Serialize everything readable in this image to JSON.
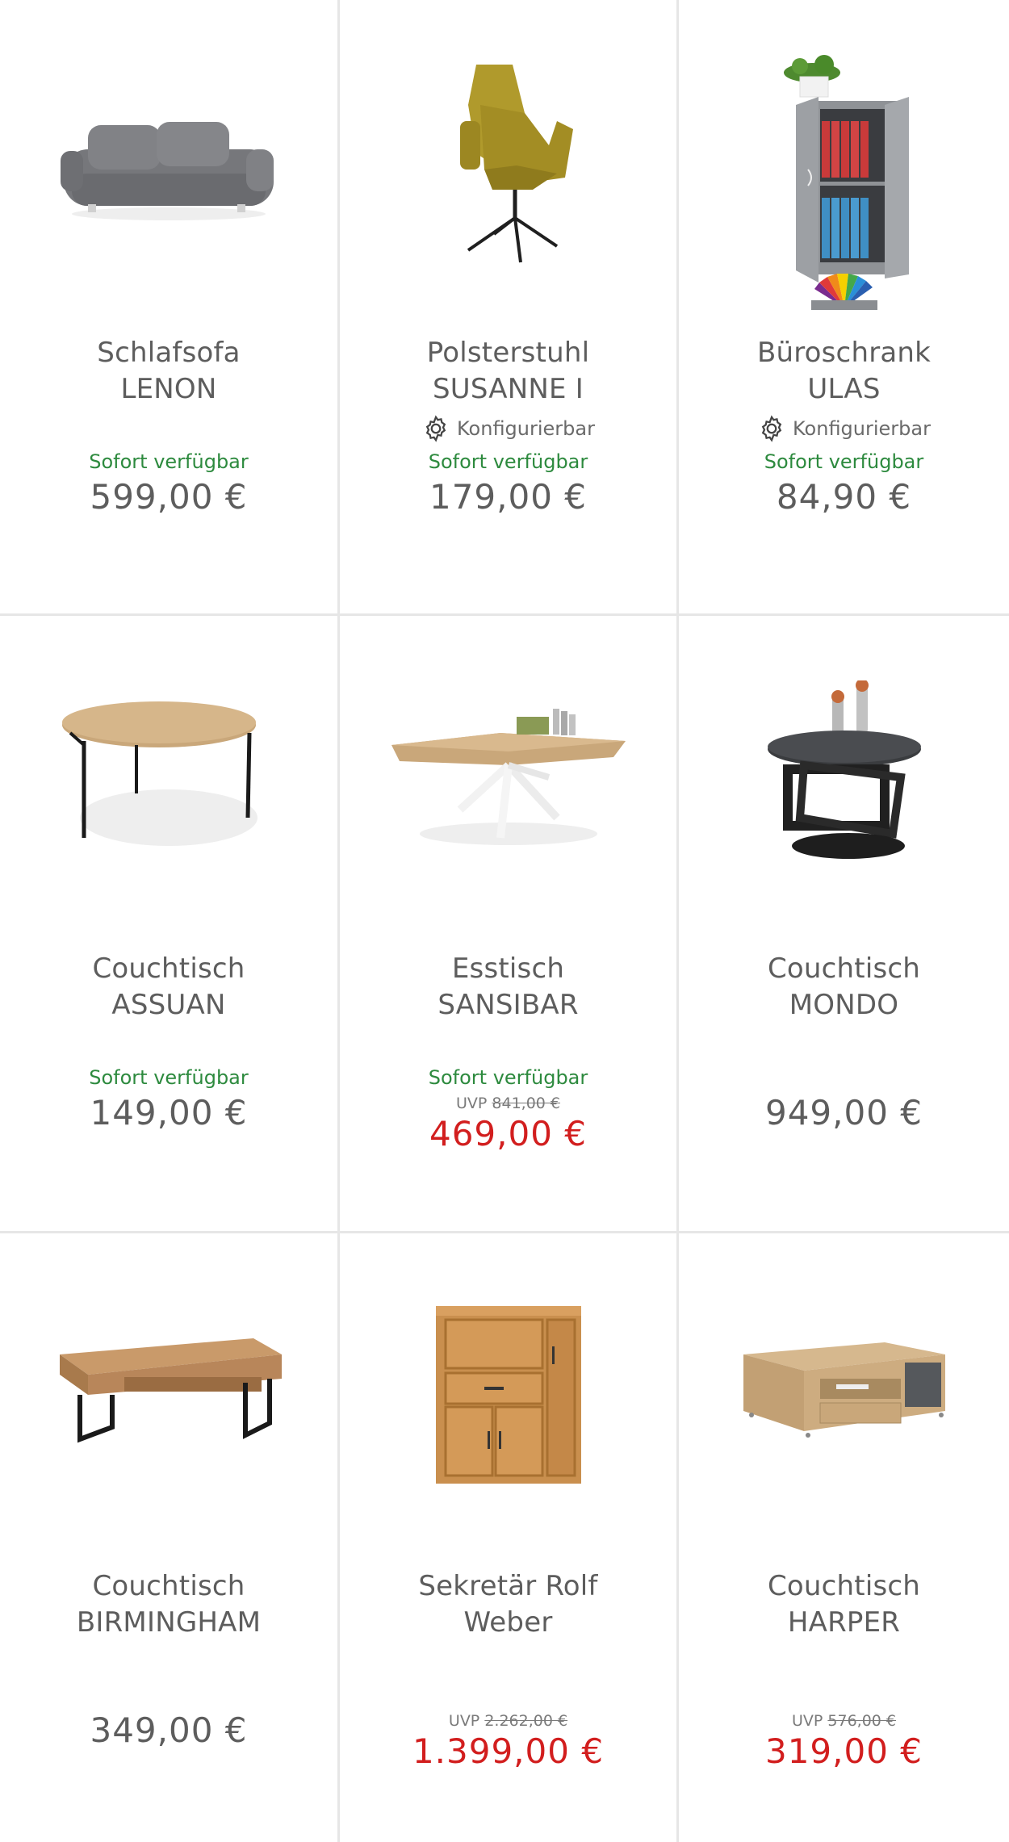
{
  "products": [
    {
      "title_line1": "Schlafsofa",
      "title_line2": "LENON",
      "configurable": "",
      "availability": "Sofort verfügbar",
      "uvp_label": "",
      "uvp_price": "",
      "price": "599,00 €",
      "sale": false,
      "image_icon": "sofa-icon"
    },
    {
      "title_line1": "Polsterstuhl",
      "title_line2": "SUSANNE I",
      "configurable": "Konfigurierbar",
      "availability": "Sofort verfügbar",
      "uvp_label": "",
      "uvp_price": "",
      "price": "179,00 €",
      "sale": false,
      "image_icon": "chair-icon"
    },
    {
      "title_line1": "Büroschrank",
      "title_line2": "ULAS",
      "configurable": "Konfigurierbar",
      "availability": "Sofort verfügbar",
      "uvp_label": "",
      "uvp_price": "",
      "price": "84,90 €",
      "sale": false,
      "image_icon": "cabinet-icon",
      "badge_icon": "color-fan-icon"
    },
    {
      "title_line1": "Couchtisch",
      "title_line2": "ASSUAN",
      "configurable": "",
      "availability": "Sofort verfügbar",
      "uvp_label": "",
      "uvp_price": "",
      "price": "149,00 €",
      "sale": false,
      "image_icon": "round-table-icon"
    },
    {
      "title_line1": "Esstisch",
      "title_line2": "SANSIBAR",
      "configurable": "",
      "availability": "Sofort verfügbar",
      "uvp_label": "UVP",
      "uvp_price": "841,00 €",
      "price": "469,00 €",
      "sale": true,
      "image_icon": "dining-table-icon"
    },
    {
      "title_line1": "Couchtisch",
      "title_line2": "MONDO",
      "configurable": "",
      "availability": "",
      "uvp_label": "",
      "uvp_price": "",
      "price": "949,00 €",
      "sale": false,
      "image_icon": "swivel-table-icon"
    },
    {
      "title_line1": "Couchtisch",
      "title_line2": "BIRMINGHAM",
      "configurable": "",
      "availability": "",
      "uvp_label": "",
      "uvp_price": "",
      "price": "349,00 €",
      "sale": false,
      "image_icon": "coffee-table-icon"
    },
    {
      "title_line1": "Sekretär Rolf",
      "title_line2": "Weber",
      "configurable": "",
      "availability": "",
      "uvp_label": "UVP",
      "uvp_price": "2.262,00 €",
      "price": "1.399,00 €",
      "sale": true,
      "image_icon": "secretary-desk-icon"
    },
    {
      "title_line1": "Couchtisch",
      "title_line2": "HARPER",
      "configurable": "",
      "availability": "",
      "uvp_label": "UVP",
      "uvp_price": "576,00 €",
      "price": "319,00 €",
      "sale": true,
      "image_icon": "tv-table-icon"
    }
  ],
  "colors": {
    "available_green": "#2d8a3e",
    "sale_red": "#d21e1e",
    "price_grey": "#5d5d5d",
    "divider": "#e6e6e6"
  }
}
